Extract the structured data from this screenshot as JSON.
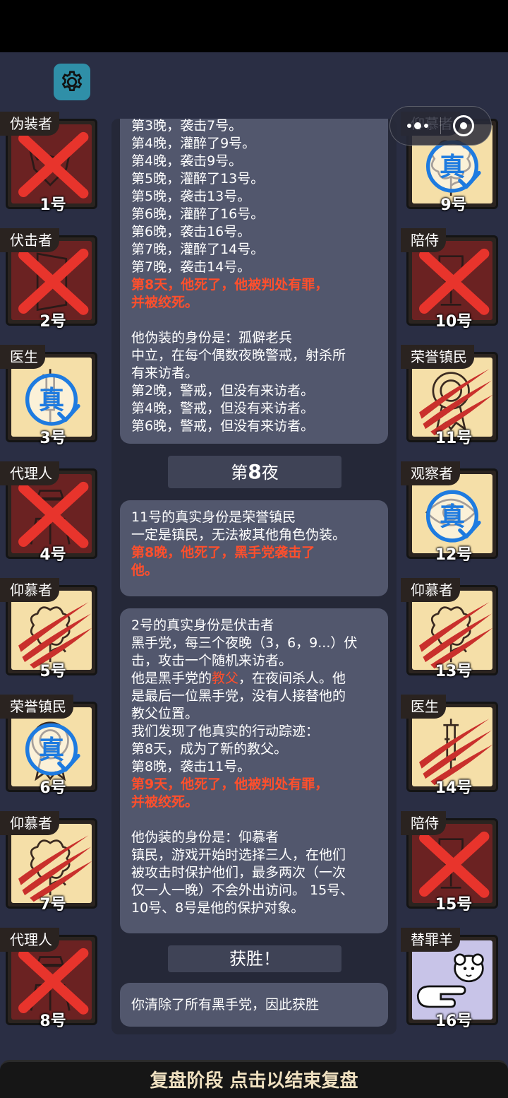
{
  "settings_icon": "gear-icon",
  "capsule": {
    "menu_icon": "dots-icon",
    "close_icon": "target-icon"
  },
  "players_left": [
    {
      "role": "伪装者",
      "number": "1号",
      "state": "dead",
      "marker": "x",
      "icon": "fox-mask-icon"
    },
    {
      "role": "伏击者",
      "number": "2号",
      "state": "dead",
      "marker": "x",
      "icon": "door-icon"
    },
    {
      "role": "医生",
      "number": "3号",
      "state": "alive",
      "marker": "true-stamp",
      "icon": "syringe-icon"
    },
    {
      "role": "代理人",
      "number": "4号",
      "state": "dead",
      "marker": "x",
      "icon": "hat-coat-icon"
    },
    {
      "role": "仰慕者",
      "number": "5号",
      "state": "alive",
      "marker": "claw",
      "icon": "flower-icon"
    },
    {
      "role": "荣誉镇民",
      "number": "6号",
      "state": "alive",
      "marker": "true-stamp",
      "icon": "medal-icon"
    },
    {
      "role": "仰慕者",
      "number": "7号",
      "state": "alive",
      "marker": "claw",
      "icon": "flower-icon"
    },
    {
      "role": "代理人",
      "number": "8号",
      "state": "dead",
      "marker": "x",
      "icon": "hat-coat-icon"
    }
  ],
  "players_right": [
    {
      "role": "仰慕者",
      "number": "9号",
      "state": "alive",
      "marker": "true-stamp",
      "icon": "flower-icon"
    },
    {
      "role": "陪侍",
      "number": "10号",
      "state": "dead",
      "marker": "x",
      "icon": "wine-glass-icon"
    },
    {
      "role": "荣誉镇民",
      "number": "11号",
      "state": "alive",
      "marker": "claw",
      "icon": "medal-icon"
    },
    {
      "role": "观察者",
      "number": "12号",
      "state": "alive",
      "marker": "true-stamp",
      "icon": "eye-icon"
    },
    {
      "role": "仰慕者",
      "number": "13号",
      "state": "alive",
      "marker": "claw",
      "icon": "flower-icon"
    },
    {
      "role": "医生",
      "number": "14号",
      "state": "alive",
      "marker": "claw",
      "icon": "syringe-icon"
    },
    {
      "role": "陪侍",
      "number": "15号",
      "state": "dead",
      "marker": "x",
      "icon": "wine-glass-icon"
    },
    {
      "role": "替罪羊",
      "number": "16号",
      "state": "scapegoat",
      "marker": "none",
      "icon": "sheep-pointing-icon"
    }
  ],
  "stamp_text": "真",
  "log": {
    "block1": {
      "l0": "第3晚，袭击7号。",
      "l1": "第4晚，灌醉了9号。",
      "l2": "第4晚，袭击9号。",
      "l3": "第5晚，灌醉了13号。",
      "l4": "第5晚，袭击13号。",
      "l5": "第6晚，灌醉了16号。",
      "l6": "第6晚，袭击16号。",
      "l7": "第7晚，灌醉了14号。",
      "l8": "第7晚，袭击14号。",
      "l9": "第8天，他死了，他被判处有罪，",
      "l10": "并被绞死。",
      "l11": "他伪装的身份是：孤僻老兵",
      "l12": "中立，在每个偶数夜晚警戒，射杀所",
      "l13": "有来访者。",
      "l14": "第2晚，警戒，但没有来访者。",
      "l15": "第4晚，警戒，但没有来访者。",
      "l16": "第6晚，警戒，但没有来访者。"
    },
    "night_header_prefix": "第",
    "night_header_num": "8",
    "night_header_suffix": "夜",
    "block2": {
      "l0": "11号的真实身份是荣誉镇民",
      "l1": "一定是镇民，无法被其他角色伪装。",
      "l2": "第8晚，他死了，黑手党袭击了",
      "l3": "他。"
    },
    "block3": {
      "l0": "2号的真实身份是伏击者",
      "l1": "黑手党，每三个夜晚（3，6，9...）伏",
      "l2": "击，攻击一个随机来访者。",
      "l3a": "他是黑手党的",
      "l3b": "教父",
      "l3c": "，在夜间杀人。他",
      "l4": "是最后一位黑手党，没有人接替他的",
      "l5": "教父位置。",
      "l6": "我们发现了他真实的行动踪迹：",
      "l7": "第8天，成为了新的教父。",
      "l8": "第8晚，袭击11号。",
      "l9": "第9天，他死了，他被判处有罪，",
      "l10": "并被绞死。",
      "l11": "他伪装的身份是：仰慕者",
      "l12": "镇民，游戏开始时选择三人，在他们",
      "l13": "被攻击时保护他们，最多两次（一次",
      "l14": "仅一人一晚）不会外出访问。 15号、",
      "l15": "10号、8号是他的保护对象。"
    },
    "victory_header": "获胜！",
    "block4": {
      "l0": "你清除了所有黑手党，因此获胜"
    }
  },
  "bottom_button": "复盘阶段 点击以结束复盘",
  "colors": {
    "background": "#2a2e44",
    "dead_card": "#6b2222",
    "alive_card": "#f5dfa8",
    "scapegoat_card": "#c8c4e8",
    "highlight": "#ff4f2c",
    "stamp_blue": "#1e7be0",
    "claw_red": "#c9302c"
  }
}
